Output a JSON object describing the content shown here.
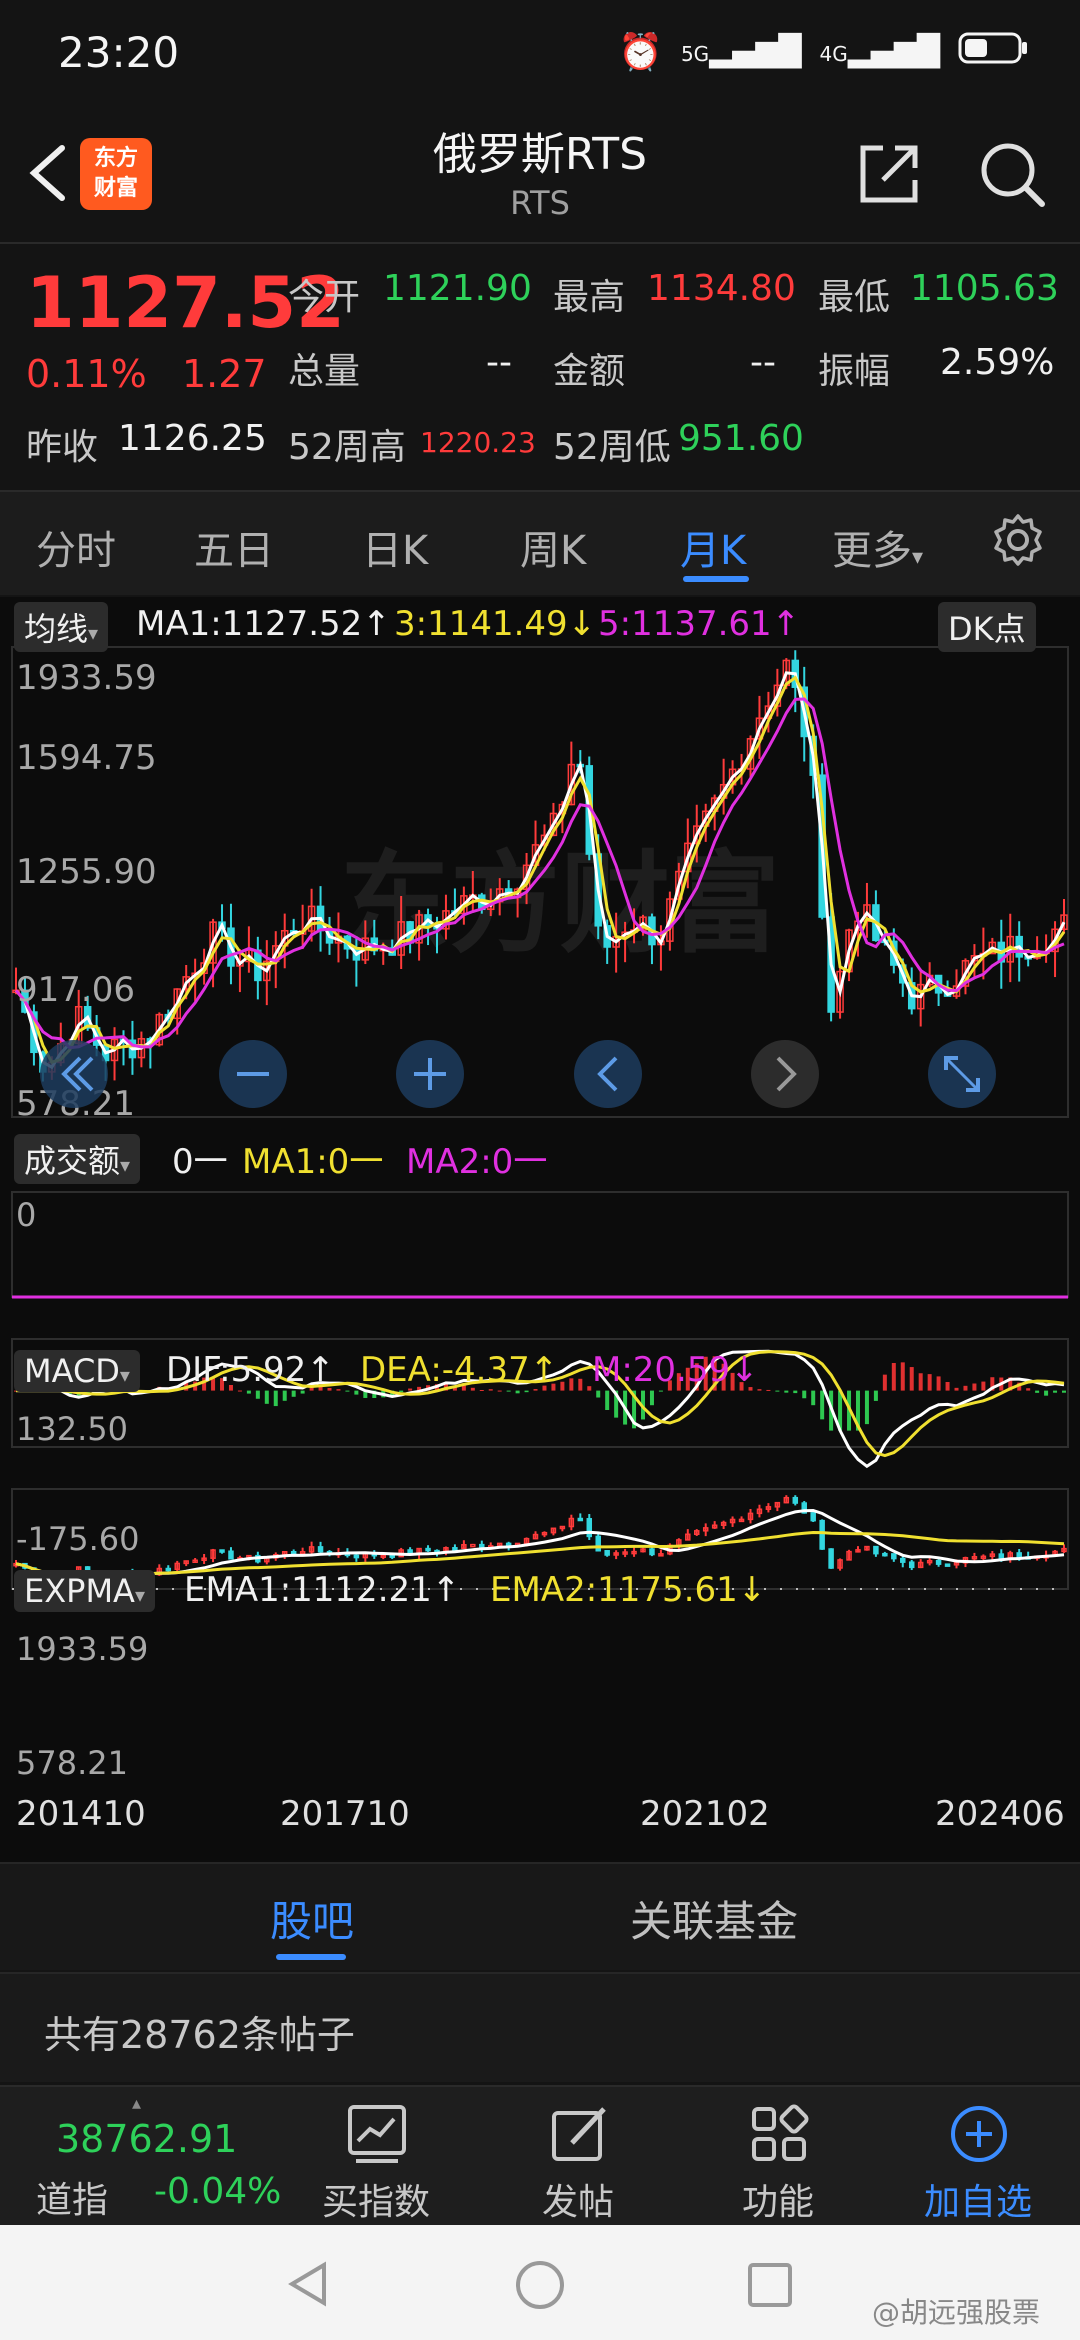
{
  "status": {
    "time": "23:20",
    "net1": "5G",
    "net2": "4G"
  },
  "header": {
    "title": "俄罗斯RTS",
    "subtitle": "RTS",
    "logo_line1": "东方",
    "logo_line2": "财富"
  },
  "quote": {
    "price": "1127.52",
    "change_pct": "0.11%",
    "change_abs": "1.27",
    "open_label": "今开",
    "open": "1121.90",
    "high_label": "最高",
    "high": "1134.80",
    "low_label": "最低",
    "low": "1105.63",
    "vol_label": "总量",
    "vol": "--",
    "amt_label": "金额",
    "amt": "--",
    "amp_label": "振幅",
    "amp": "2.59%",
    "prev_label": "昨收",
    "prev": "1126.25",
    "w52h_label": "52周高",
    "w52h": "1220.23",
    "w52l_label": "52周低",
    "w52l": "951.60"
  },
  "tabs": [
    "分时",
    "五日",
    "日K",
    "周K",
    "月K",
    "更多"
  ],
  "main_legend": {
    "btn": "均线",
    "ma1": "MA1:1127.52↑",
    "ma3": "3:1141.49↓",
    "ma5": "5:1137.61↑",
    "dk": "DK点"
  },
  "main_axis": {
    "t1": "1933.59",
    "t2": "1594.75",
    "t3": "1255.90",
    "t4": "917.06",
    "t5": "578.21"
  },
  "vol_legend": {
    "btn": "成交额",
    "v0": "0一",
    "ma1": "MA1:0一",
    "ma2": "MA2:0一",
    "axis0": "0"
  },
  "macd_legend": {
    "btn": "MACD",
    "dif": "DIF:5.92↑",
    "dea": "DEA:-4.37↑",
    "m": "M:20.59↓",
    "top": "132.50",
    "bot": "-175.60"
  },
  "expma_legend": {
    "btn": "EXPMA",
    "ema1": "EMA1:1112.21↑",
    "ema2": "EMA2:1175.61↓",
    "top": "1933.59",
    "bot": "578.21"
  },
  "x_axis": [
    "201410",
    "201710",
    "202102",
    "202406"
  ],
  "bottom_tabs": [
    "股吧",
    "关联基金"
  ],
  "posts": "共有28762条帖子",
  "bottom_nav": {
    "index_value": "38762.91",
    "index_name": "道指",
    "index_change": "-0.04%",
    "items": [
      "买指数",
      "发帖",
      "功能",
      "加自选"
    ]
  },
  "watermark": "东方财富",
  "credit": "@胡远强股票",
  "colors": {
    "up": "#ff3b3b",
    "down": "#2ed15a",
    "accent": "#3b8cff",
    "ma1": "#ffffff",
    "ma3": "#f0e030",
    "ma5": "#e030e0"
  }
}
